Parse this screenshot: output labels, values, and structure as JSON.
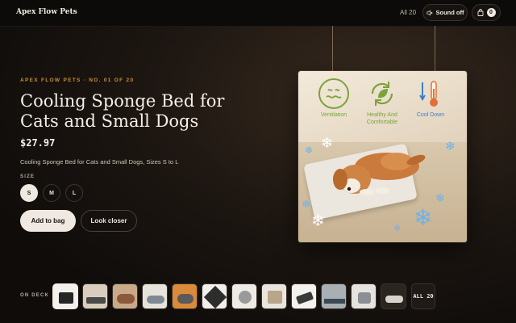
{
  "header": {
    "brand": "Apex Flow Pets",
    "all_link": "All 20",
    "sound_label": "Sound off",
    "bag_count": "0"
  },
  "product": {
    "eyebrow": "APEX FLOW PETS · NO. 01 OF 20",
    "title": "Cooling Sponge Bed for Cats and Small Dogs",
    "price": "$27.97",
    "description": "Cooling Sponge Bed for Cats and Small Dogs, Sizes S to L",
    "size_label": "SIZE",
    "sizes": [
      "S",
      "M",
      "L"
    ],
    "selected_size": "S",
    "add_to_bag": "Add to bag",
    "look_closer": "Look closer"
  },
  "image": {
    "features": [
      "Ventilation",
      "Healthy And Comfortable",
      "Cool Down"
    ]
  },
  "deck": {
    "label": "ON DECK",
    "thumb_count": 12,
    "all_tile": "ALL 20"
  },
  "colors": {
    "accent": "#c9902f",
    "background": "#0f0c0a",
    "button_light": "#efe9e1",
    "feature_green": "#7aa33a",
    "feature_blue": "#3f7fc2"
  },
  "icons": [
    "speaker-mute-icon",
    "bag-icon",
    "ventilation-icon",
    "recycle-leaf-icon",
    "thermometer-icon",
    "snowflake-icon"
  ]
}
